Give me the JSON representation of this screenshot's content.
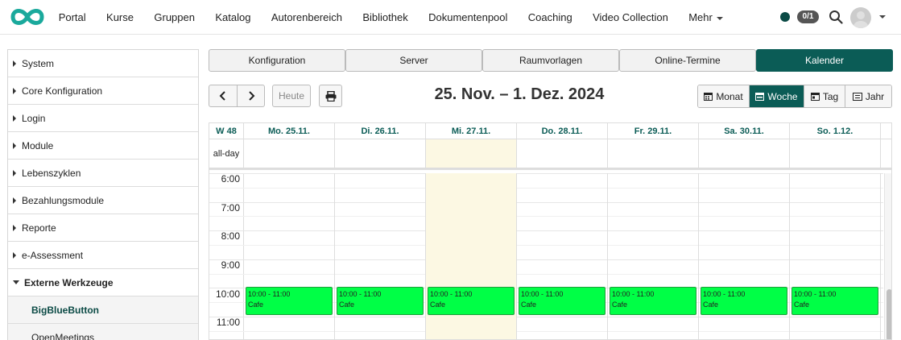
{
  "colors": {
    "brand": "#0b5c56",
    "event": "#00ff46",
    "today": "#fcf8e3"
  },
  "nav": {
    "items": [
      "Portal",
      "Kurse",
      "Gruppen",
      "Katalog",
      "Autorenbereich",
      "Bibliothek",
      "Dokumentenpool",
      "Coaching",
      "Video Collection"
    ],
    "more": "Mehr"
  },
  "header": {
    "badge": "0/1",
    "icons": [
      "logo-icon",
      "status-dot-icon",
      "search-icon",
      "avatar-icon"
    ]
  },
  "sidebar": {
    "items": [
      "System",
      "Core Konfiguration",
      "Login",
      "Module",
      "Lebenszyklen",
      "Bezahlungsmodule",
      "Reporte",
      "e-Assessment"
    ],
    "open": "Externe Werkzeuge",
    "sub": [
      "BigBlueButton",
      "OpenMeetings"
    ]
  },
  "tabs": [
    "Konfiguration",
    "Server",
    "Raumvorlagen",
    "Online-Termine",
    "Kalender"
  ],
  "toolbar": {
    "today": "Heute",
    "title": "25. Nov. – 1. Dez. 2024",
    "views": [
      "Monat",
      "Woche",
      "Tag",
      "Jahr"
    ]
  },
  "calendar": {
    "week": "W 48",
    "days": [
      "Mo. 25.11.",
      "Di. 26.11.",
      "Mi. 27.11.",
      "Do. 28.11.",
      "Fr. 29.11.",
      "Sa. 30.11.",
      "So. 1.12."
    ],
    "allday": "all-day",
    "times": [
      "6:00",
      "7:00",
      "8:00",
      "9:00",
      "10:00",
      "11:00"
    ],
    "events": [
      {
        "time": "10:00 - 11:00",
        "title": "Cafe"
      },
      {
        "time": "10:00 - 11:00",
        "title": "Cafe"
      },
      {
        "time": "10:00 - 11:00",
        "title": "Cafe"
      },
      {
        "time": "10:00 - 11:00",
        "title": "Cafe"
      },
      {
        "time": "10:00 - 11:00",
        "title": "Cafe"
      },
      {
        "time": "10:00 - 11:00",
        "title": "Cafe"
      },
      {
        "time": "10:00 - 11:00",
        "title": "Cafe"
      }
    ]
  }
}
